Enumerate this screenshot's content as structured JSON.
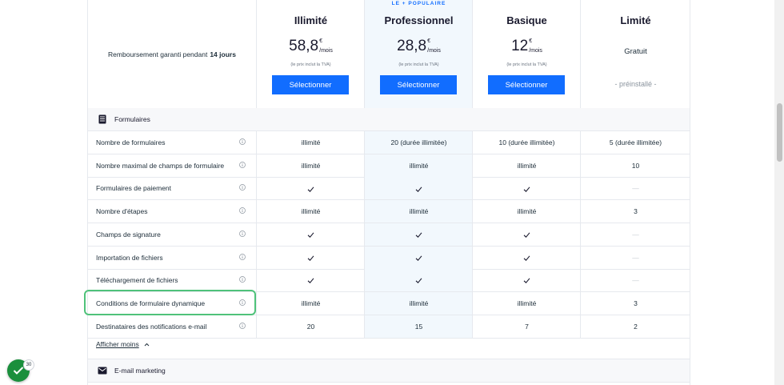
{
  "refund": {
    "text": "Remboursement garanti pendant",
    "bold": "14 jours"
  },
  "plans": [
    {
      "name": "Illimité",
      "price": "58,8",
      "currency": "€",
      "period": "/mois",
      "vat": "(le prix inclut la TVA)",
      "button": "Sélectionner"
    },
    {
      "name": "Professionnel",
      "badge": "LE + POPULAIRE",
      "price": "28,8",
      "currency": "€",
      "period": "/mois",
      "vat": "(le prix inclut la TVA)",
      "button": "Sélectionner"
    },
    {
      "name": "Basique",
      "price": "12",
      "currency": "€",
      "period": "/mois",
      "vat": "(le prix inclut la TVA)",
      "button": "Sélectionner"
    },
    {
      "name": "Limité",
      "free_label": "Gratuit",
      "status": "- préinstallé -"
    }
  ],
  "sections": {
    "forms": "Formulaires",
    "email": "E-mail marketing"
  },
  "rows": [
    {
      "label": "Nombre de formulaires",
      "values": [
        "illimité",
        "20 (durée illimitée)",
        "10 (durée illimitée)",
        "5 (durée illimitée)"
      ]
    },
    {
      "label": "Nombre maximal de champs de formulaire",
      "values": [
        "illimité",
        "illimité",
        "illimité",
        "10"
      ]
    },
    {
      "label": "Formulaires de paiement",
      "values": [
        "check",
        "check",
        "check",
        "—"
      ]
    },
    {
      "label": "Nombre d'étapes",
      "values": [
        "illimité",
        "illimité",
        "illimité",
        "3"
      ]
    },
    {
      "label": "Champs de signature",
      "values": [
        "check",
        "check",
        "check",
        "—"
      ]
    },
    {
      "label": "Importation de fichiers",
      "values": [
        "check",
        "check",
        "check",
        "—"
      ]
    },
    {
      "label": "Téléchargement de fichiers",
      "values": [
        "check",
        "check",
        "check",
        "—"
      ]
    },
    {
      "label": "Conditions de formulaire dynamique",
      "values": [
        "illimité",
        "illimité",
        "illimité",
        "3"
      ]
    },
    {
      "label": "Destinataires des notifications e-mail",
      "values": [
        "20",
        "15",
        "7",
        "2"
      ]
    }
  ],
  "show_less": "Afficher moins",
  "task_count": "30",
  "colors": {
    "accent": "#116dff",
    "highlight": "#4fc27a",
    "popular_bg": "#f2f8fd",
    "done": "#1a8f3c"
  }
}
